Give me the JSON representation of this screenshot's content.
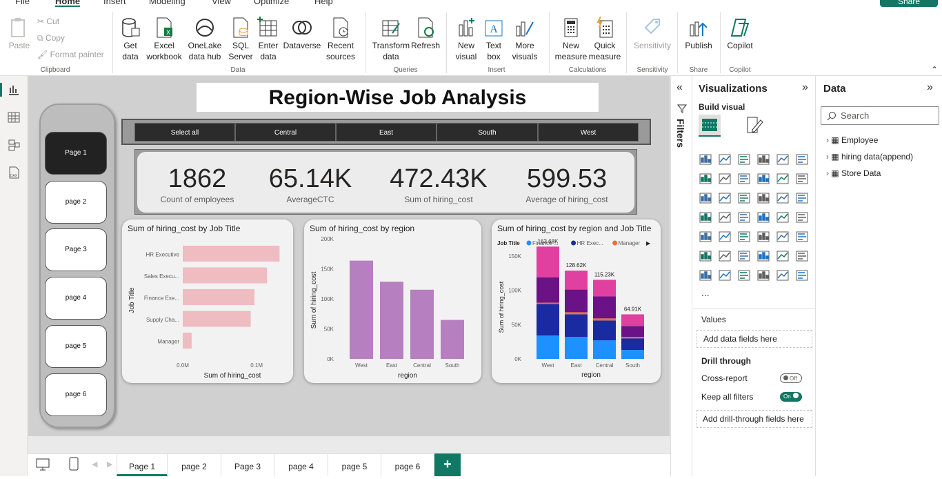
{
  "menu": {
    "items": [
      "File",
      "Home",
      "Insert",
      "Modeling",
      "View",
      "Optimize",
      "Help"
    ],
    "share": "Share"
  },
  "ribbon": {
    "clipboard": {
      "paste": "Paste",
      "cut": "Cut",
      "copy": "Copy",
      "format_painter": "Format painter",
      "group": "Clipboard"
    },
    "data": {
      "get_data": [
        "Get",
        "data"
      ],
      "excel": [
        "Excel",
        "workbook"
      ],
      "onelake": [
        "OneLake",
        "data hub"
      ],
      "sql": [
        "SQL",
        "Server"
      ],
      "enter": [
        "Enter",
        "data"
      ],
      "dataverse": [
        "Dataverse",
        ""
      ],
      "recent": [
        "Recent",
        "sources"
      ],
      "group": "Data"
    },
    "queries": {
      "transform": [
        "Transform",
        "data"
      ],
      "refresh": [
        "Refresh",
        ""
      ],
      "group": "Queries"
    },
    "insert": {
      "new_visual": [
        "New",
        "visual"
      ],
      "text_box": [
        "Text",
        "box"
      ],
      "more_visuals": [
        "More",
        "visuals"
      ],
      "group": "Insert"
    },
    "calculations": {
      "new_measure": [
        "New",
        "measure"
      ],
      "quick_measure": [
        "Quick",
        "measure"
      ],
      "group": "Calculations"
    },
    "sensitivity": {
      "label": [
        "Sensitivity",
        ""
      ],
      "group": "Sensitivity"
    },
    "share": {
      "publish": [
        "Publish",
        ""
      ],
      "group": "Share"
    },
    "copilot": {
      "label": [
        "Copilot",
        ""
      ],
      "group": "Copilot"
    }
  },
  "report": {
    "title": "Region-Wise Job Analysis",
    "pages_nav": [
      "Page 1",
      "page 2",
      "Page 3",
      "page 4",
      "page 5",
      "page 6"
    ],
    "slicer": [
      "Select all",
      "Central",
      "East",
      "South",
      "West"
    ],
    "kpis": [
      {
        "value": "1862",
        "label": "Count of employees"
      },
      {
        "value": "65.14K",
        "label": "AverageCTC"
      },
      {
        "value": "472.43K",
        "label": "Sum of hiring_cost"
      },
      {
        "value": "599.53",
        "label": "Average of hiring_cost"
      }
    ]
  },
  "chart_data": [
    {
      "type": "bar",
      "orientation": "horizontal",
      "title": "Sum of hiring_cost by Job Title",
      "categories": [
        "HR Executive",
        "Sales Execu...",
        "Finance Exe...",
        "Supply Cha...",
        "Manager"
      ],
      "values": [
        131000,
        114000,
        97000,
        92000,
        12000
      ],
      "xlabel": "Sum of hiring_cost",
      "ylabel": "Job Title",
      "xticks": [
        "0.0M",
        "0.1M"
      ],
      "xlim": [
        0,
        140000
      ],
      "color": "#eebcc1"
    },
    {
      "type": "bar",
      "title": "Sum of hiring_cost by region",
      "categories": [
        "West",
        "East",
        "Central",
        "South"
      ],
      "values": [
        163680,
        128620,
        115230,
        64910
      ],
      "xlabel": "region",
      "ylabel": "Sum of hiring_cost",
      "yticks": [
        "0K",
        "50K",
        "100K",
        "150K",
        "200K"
      ],
      "ylim": [
        0,
        200000
      ],
      "color": "#b67fbf"
    },
    {
      "type": "bar",
      "stacked": true,
      "title": "Sum of hiring_cost by region and Job Title",
      "legend_title": "Job Title",
      "legend": [
        {
          "name": "Finance ...",
          "color": "#1e90ff"
        },
        {
          "name": "HR Exec...",
          "color": "#1a2aa0"
        },
        {
          "name": "Manager",
          "color": "#f26b3a"
        }
      ],
      "categories": [
        "West",
        "East",
        "Central",
        "South"
      ],
      "totals_labels": [
        "163.68K",
        "128.62K",
        "115.23K",
        "64.91K"
      ],
      "series": [
        {
          "values": [
            34000,
            32000,
            27000,
            13000
          ],
          "color": "#1e90ff"
        },
        {
          "values": [
            46000,
            33000,
            29000,
            17000
          ],
          "color": "#1a2aa0"
        },
        {
          "values": [
            2000,
            3000,
            3000,
            2000
          ],
          "color": "#f26b3a"
        },
        {
          "values": [
            37000,
            33000,
            32000,
            16000
          ],
          "color": "#6b1287"
        },
        {
          "values": [
            44680,
            27620,
            24230,
            16910
          ],
          "color": "#e040a0"
        }
      ],
      "xlabel": "region",
      "ylabel": "Sum of hiring_cost",
      "yticks": [
        "0K",
        "50K",
        "100K",
        "150K"
      ],
      "ylim": [
        0,
        175000
      ]
    }
  ],
  "tabs": [
    "Page 1",
    "page 2",
    "Page 3",
    "page 4",
    "page 5",
    "page 6"
  ],
  "filters": {
    "label": "Filters"
  },
  "viz_pane": {
    "title": "Visualizations",
    "build": "Build visual",
    "more": "...",
    "values": "Values",
    "add_fields": "Add data fields here",
    "drill": "Drill through",
    "cross_report": "Cross-report",
    "cross_state": "Off",
    "keep_filters": "Keep all filters",
    "keep_state": "On",
    "add_drill": "Add drill-through fields here"
  },
  "data_pane": {
    "title": "Data",
    "search": "Search",
    "tables": [
      "Employee",
      "hiring data(append)",
      "Store Data"
    ]
  }
}
